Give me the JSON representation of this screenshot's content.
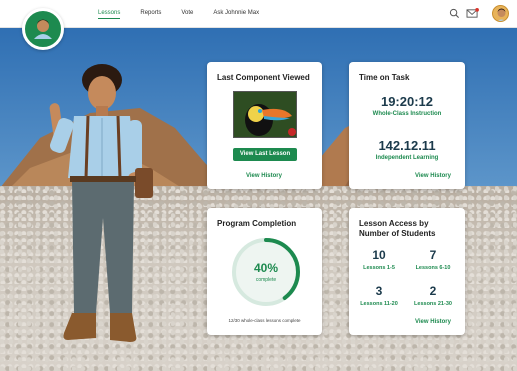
{
  "nav": {
    "items": [
      {
        "label": "Lessons",
        "active": true
      },
      {
        "label": "Reports",
        "active": false
      },
      {
        "label": "Vote",
        "active": false
      },
      {
        "label": "Ask Johnnie Max",
        "active": false
      }
    ],
    "icons": [
      "search-icon",
      "mail-icon",
      "profile-avatar"
    ]
  },
  "colors": {
    "accent": "#1d8a4f",
    "navy": "#1b3a4b"
  },
  "last_component": {
    "title": "Last Component Viewed",
    "button_label": "View Last Lesson",
    "history_link": "View History"
  },
  "time_on_task": {
    "title": "Time on Task",
    "whole_class_time": "19:20:12",
    "whole_class_label": "Whole-Class Instruction",
    "independent_time": "142.12.11",
    "independent_label": "Independent Learning",
    "history_link": "View History"
  },
  "program_completion": {
    "title": "Program Completion",
    "percent_text": "40%",
    "percent_value": 40,
    "percent_label": "complete",
    "note": "12/30 whole-class lessons complete"
  },
  "lesson_access": {
    "title_line1": "Lesson Access by",
    "title_line2": "Number of Students",
    "stats": [
      {
        "count": "10",
        "label": "Lessons 1-5"
      },
      {
        "count": "7",
        "label": "Lessons 6-10"
      },
      {
        "count": "3",
        "label": "Lessons 11-20"
      },
      {
        "count": "2",
        "label": "Lessons 21-30"
      }
    ],
    "history_link": "View History"
  }
}
